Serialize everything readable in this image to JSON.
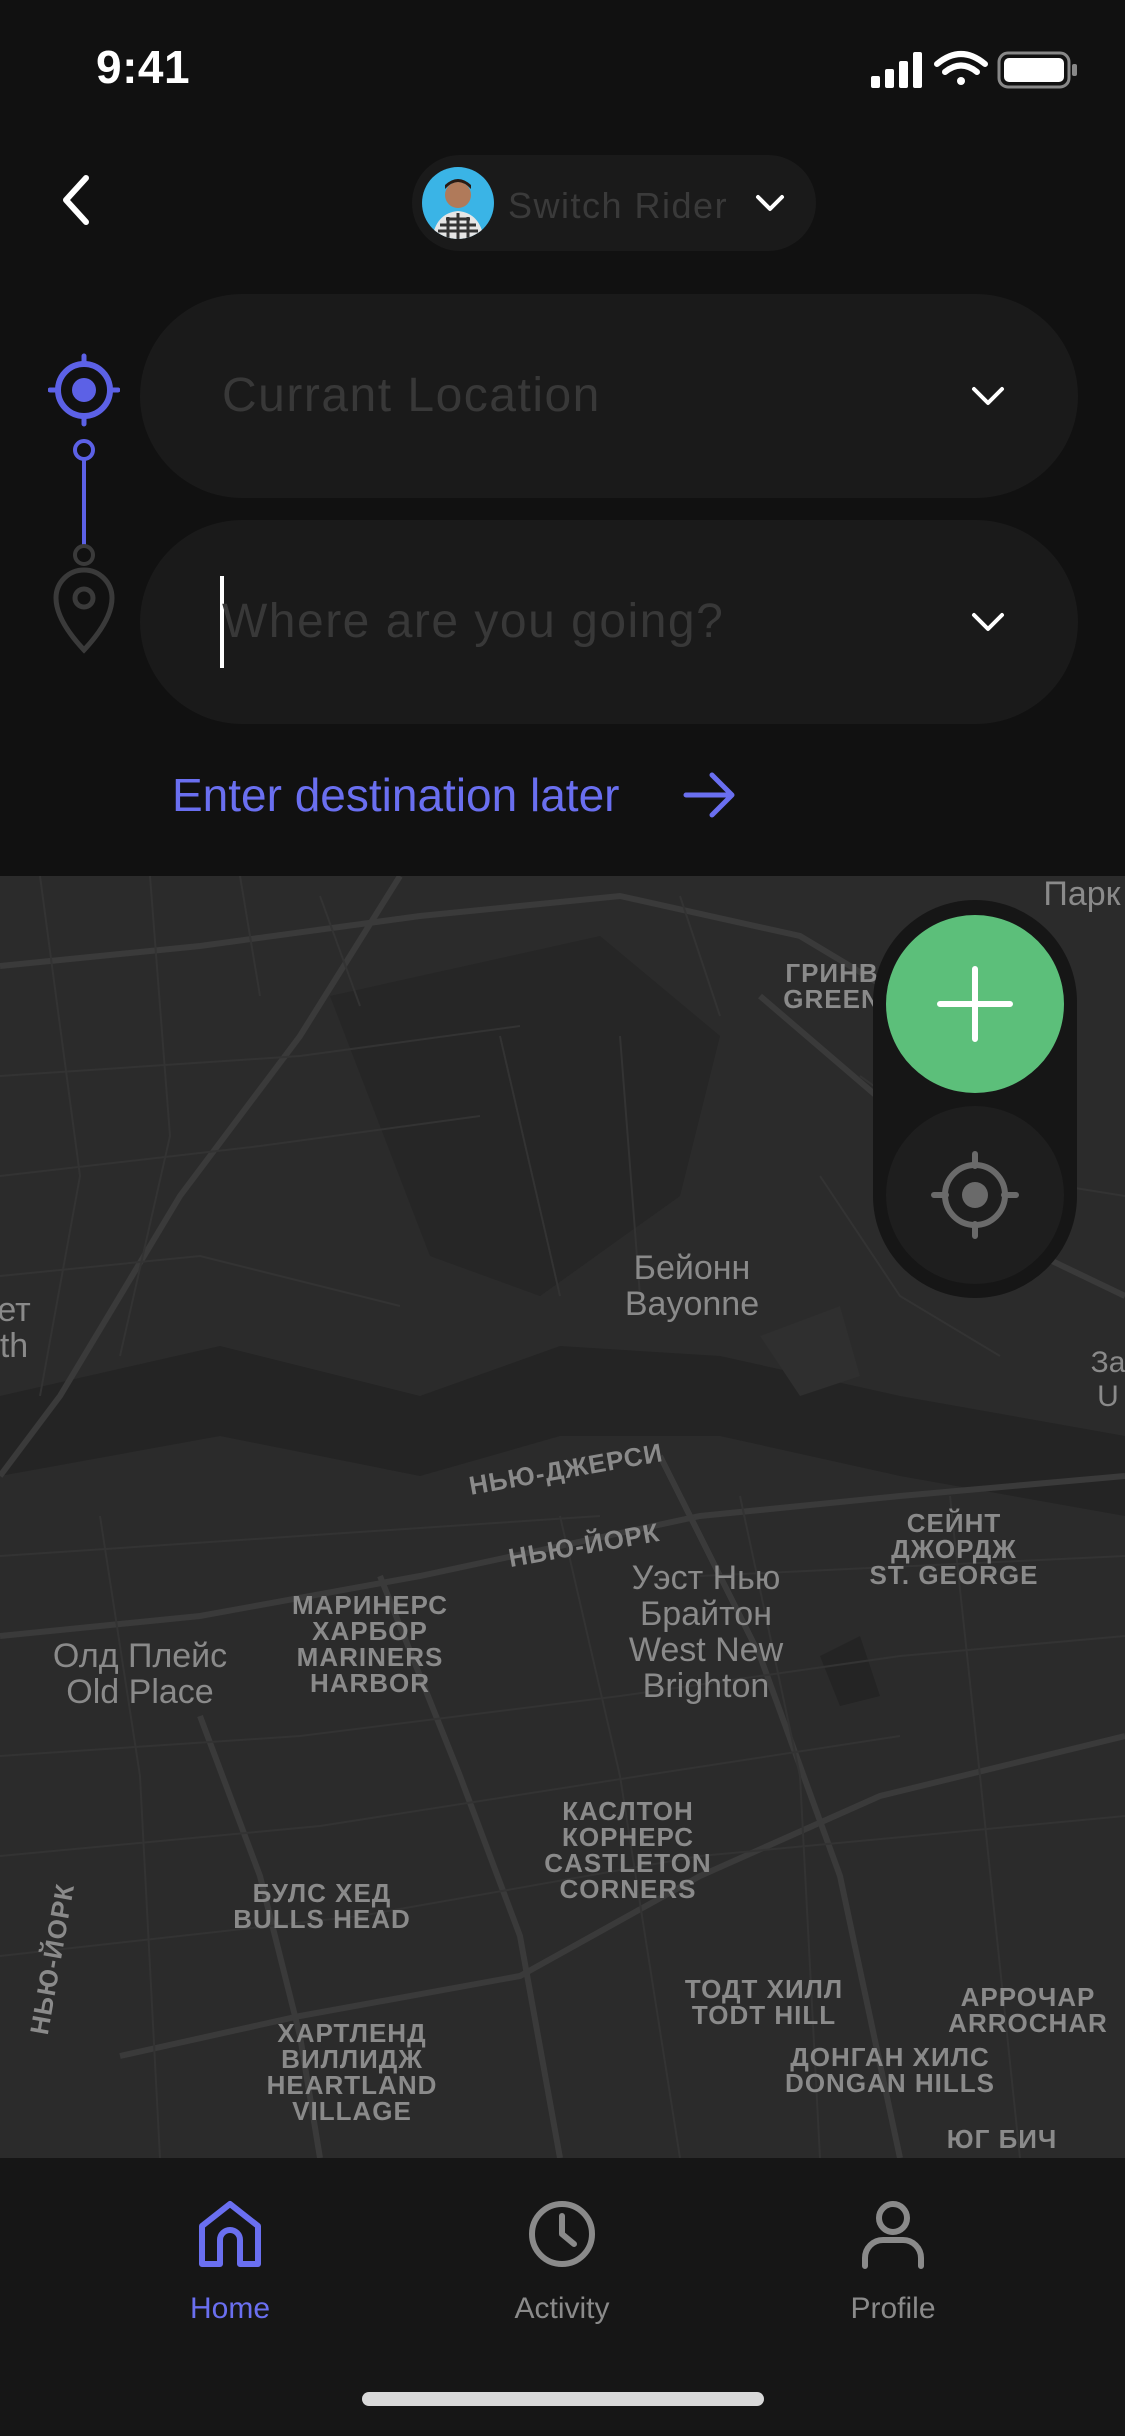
{
  "status_bar": {
    "time": "9:41"
  },
  "header": {
    "rider_label": "Switch Rider",
    "icons": {
      "back": "chevron-left-icon",
      "rider_dropdown": "chevron-down-icon"
    }
  },
  "route": {
    "pickup": {
      "placeholder": "Currant Location",
      "icon": "target-icon"
    },
    "destination": {
      "placeholder": "Where are you going?",
      "icon": "pin-icon"
    },
    "enter_later_label": "Enter destination later"
  },
  "map": {
    "labels": [
      {
        "text": "Парк",
        "cls": "big"
      },
      {
        "text": "ГРИНВ\nGREEN",
        "cls": "caps"
      },
      {
        "text": "Бейонн\nBayonne",
        "cls": "big"
      },
      {
        "text": "ет\nth",
        "cls": "big"
      },
      {
        "text": "За\nU",
        "cls": ""
      },
      {
        "text": "НЬЮ-ДЖЕРСИ",
        "cls": "caps"
      },
      {
        "text": "НЬЮ-ЙОРК",
        "cls": "caps"
      },
      {
        "text": "СЕЙНТ\nДЖОРДЖ\nST. GEORGE",
        "cls": "caps"
      },
      {
        "text": "МАРИНЕРС\nХАРБОР\nMARINERS\nHARBOR",
        "cls": "caps"
      },
      {
        "text": "Уэст Нью\nБрайтон\nWest New\nBrighton",
        "cls": "big"
      },
      {
        "text": "Олд Плейс\nOld Place",
        "cls": "big"
      },
      {
        "text": "КАСЛТОН\nКОРНЕРС\nCASTLETON\nCORNERS",
        "cls": "caps"
      },
      {
        "text": "БУЛС ХЕД\nBULLS HEAD",
        "cls": "caps"
      },
      {
        "text": "НЬЮ-ЙОРК",
        "cls": "caps"
      },
      {
        "text": "ТОДТ ХИЛЛ\nTODT HILL",
        "cls": "caps"
      },
      {
        "text": "АРРОЧАР\nARROCHAR",
        "cls": "caps"
      },
      {
        "text": "ХАРТЛЕНД\nВИЛЛИДЖ\nHEARTLAND\nVILLAGE",
        "cls": "caps"
      },
      {
        "text": "ДОНГАН ХИЛС\nDONGAN HILLS",
        "cls": "caps"
      },
      {
        "text": "ЮГ БИЧ",
        "cls": "caps"
      }
    ]
  },
  "map_controls": {
    "add_icon": "plus-icon",
    "locate_icon": "crosshair-icon",
    "add_color": "#5cbf7a"
  },
  "bottom_nav": {
    "items": [
      {
        "label": "Home",
        "icon": "home-icon",
        "active": true
      },
      {
        "label": "Activity",
        "icon": "clock-icon",
        "active": false
      },
      {
        "label": "Profile",
        "icon": "user-icon",
        "active": false
      }
    ]
  },
  "colors": {
    "accent": "#6a6ff0",
    "background": "#111111",
    "field": "#1a1a1a",
    "map": "#2b2b2b"
  }
}
